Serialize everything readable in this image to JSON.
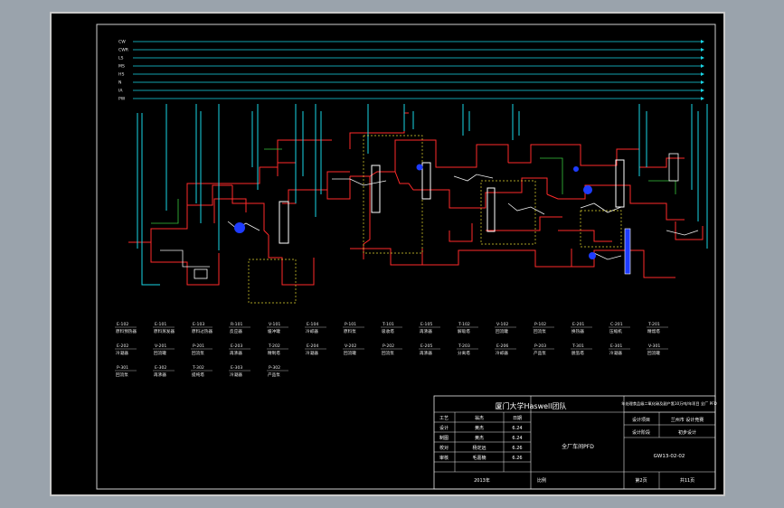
{
  "title_block": {
    "team": "厦门大学Haswell团队",
    "project_desc": "年处理食品级二氧化碳及副产氢10万吨/年项目 全厂 PFD",
    "drawing_name": "全厂车间PFD",
    "design_project_label": "设计项目",
    "design_project_value": "兰州市 设计竞赛",
    "design_stage_label": "设计阶段",
    "design_stage_value": "初步设计",
    "drawing_no": "GW13-02-02",
    "year_label": "2013年",
    "scale_label": "比例",
    "sheet_label": "第2页",
    "total_label": "共11页",
    "rows": [
      {
        "role": "工艺",
        "name": "翁杰",
        "date": "日期"
      },
      {
        "role": "设计",
        "name": "黄杰",
        "date": "6.24"
      },
      {
        "role": "制图",
        "name": "黄杰",
        "date": "6.24"
      },
      {
        "role": "校对",
        "name": "杨定远",
        "date": "6.26"
      },
      {
        "role": "审核",
        "name": "毛嘉楠",
        "date": "6.26"
      }
    ]
  },
  "header_lines": [
    "CW",
    "CWR",
    "LS",
    "MS",
    "HS",
    "N",
    "IA",
    "PW"
  ],
  "equipment_labels": [
    {
      "tag": "E-102",
      "name": "原料预热器"
    },
    {
      "tag": "E-101",
      "name": "原料蒸发器"
    },
    {
      "tag": "E-103",
      "name": "原料过热器"
    },
    {
      "tag": "R-101",
      "name": "反应器"
    },
    {
      "tag": "V-101",
      "name": "缓冲罐"
    },
    {
      "tag": "E-104",
      "name": "冷却器"
    },
    {
      "tag": "P-101",
      "name": "原料泵"
    },
    {
      "tag": "T-101",
      "name": "吸收塔"
    },
    {
      "tag": "E-105",
      "name": "再沸器"
    },
    {
      "tag": "T-102",
      "name": "解吸塔"
    },
    {
      "tag": "V-102",
      "name": "回流罐"
    },
    {
      "tag": "P-102",
      "name": "回流泵"
    },
    {
      "tag": "E-201",
      "name": "换热器"
    },
    {
      "tag": "C-201",
      "name": "压缩机"
    },
    {
      "tag": "T-201",
      "name": "精馏塔"
    },
    {
      "tag": "E-202",
      "name": "冷凝器"
    },
    {
      "tag": "V-201",
      "name": "回流罐"
    },
    {
      "tag": "P-201",
      "name": "回流泵"
    },
    {
      "tag": "E-203",
      "name": "再沸器"
    },
    {
      "tag": "T-202",
      "name": "精制塔"
    },
    {
      "tag": "E-204",
      "name": "冷凝器"
    },
    {
      "tag": "V-202",
      "name": "回流罐"
    },
    {
      "tag": "P-202",
      "name": "回流泵"
    },
    {
      "tag": "E-205",
      "name": "再沸器"
    },
    {
      "tag": "T-203",
      "name": "分离塔"
    },
    {
      "tag": "E-206",
      "name": "冷却器"
    },
    {
      "tag": "P-203",
      "name": "产品泵"
    },
    {
      "tag": "T-301",
      "name": "脱氢塔"
    },
    {
      "tag": "E-301",
      "name": "冷凝器"
    },
    {
      "tag": "V-301",
      "name": "回流罐"
    },
    {
      "tag": "P-301",
      "name": "回流泵"
    },
    {
      "tag": "E-302",
      "name": "再沸器"
    },
    {
      "tag": "T-302",
      "name": "提纯塔"
    },
    {
      "tag": "E-303",
      "name": "冷凝器"
    },
    {
      "tag": "P-302",
      "name": "产品泵"
    }
  ]
}
